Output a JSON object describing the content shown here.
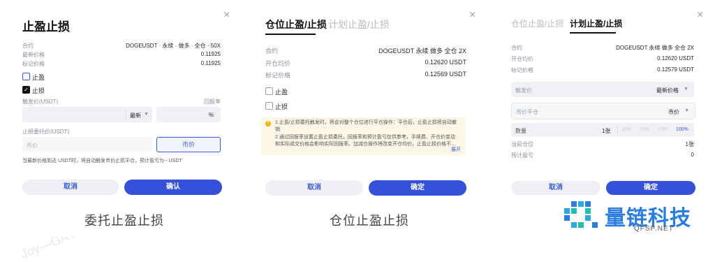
{
  "watermark": "Joy—GA Jul 24, 2024, 3:41 PM RDJ",
  "close_glyph": "×",
  "panel1": {
    "title": "止盈止损",
    "rows": [
      {
        "label": "合约",
        "value": "DOGEUSDT · 永续 · 做多 · 全仓 · 50X"
      },
      {
        "label": "最新价格",
        "value": "0.11925"
      },
      {
        "label": "标记价格",
        "value": "0.11925"
      }
    ],
    "take_profit_label": "止盈",
    "stop_loss_label": "止损",
    "stop_loss_checked": true,
    "trigger_label": "触发价(USDT)",
    "return_label": "回报率",
    "trigger_type": "最新",
    "percent_symbol": "%",
    "order_price_label": "止损委托价(USDT)",
    "market_price_placeholder": "市价",
    "market_button": "市价",
    "hint": "当最新价格到达 USDT时，将自动触发市价止损平仓，预计盈亏为-- USDT",
    "cancel": "取消",
    "confirm": "确认"
  },
  "panel2": {
    "tabs": [
      "仓位止盈/止损",
      "计划止盈/止损"
    ],
    "active_tab": 0,
    "rows": [
      {
        "label": "合约",
        "value": "DOGEUSDT  永续  做多  全仓  2X"
      },
      {
        "label": "开仓均价",
        "value": "0.12620 USDT"
      },
      {
        "label": "标记价格",
        "value": "0.12569 USDT"
      }
    ],
    "take_profit_label": "止盈",
    "stop_loss_label": "止损",
    "notice_lines": [
      "1.止盈/止损委托触发时，将会对整个仓位进行平仓操作：平仓后，止盈止损将自动撤",
      "销",
      "2.通过回报率设置止盈止损委托，回报率和预计盈亏仅供参考，手续费、开仓价变动",
      "和实际成交价格会影响实际回报率。加减仓操作将改变开仓均价，止盈止损价格不..."
    ],
    "notice_expand": "展开",
    "cancel": "取消",
    "confirm": "确定"
  },
  "panel3": {
    "tabs": [
      "仓位止盈/止损",
      "计划止盈/止损"
    ],
    "active_tab": 1,
    "rows": [
      {
        "label": "合约",
        "value": "DOGEUSDT  永续  做多  全仓  2X"
      },
      {
        "label": "开仓均价",
        "value": "0.12620 USDT"
      },
      {
        "label": "标记价格",
        "value": "0.12579 USDT"
      }
    ],
    "trigger_placeholder": "触发价",
    "trigger_type": "最新价格",
    "price_placeholder": "市价平仓",
    "price_type": "市价",
    "qty_label": "数量",
    "qty_value": "1张",
    "qty_percents": [
      "25%",
      "50%",
      "75%",
      "100%"
    ],
    "current_position_label": "当前仓位",
    "current_position_value": "1张",
    "expected_pnl_label": "预计盈亏",
    "expected_pnl_value": "0",
    "cancel": "取消",
    "confirm": "确定"
  },
  "captions": [
    "委托止盈止损",
    "仓位止盈止损"
  ],
  "brand": {
    "name": "量链科技",
    "sub": "QFSP.NET",
    "color": "#2a7de0"
  }
}
